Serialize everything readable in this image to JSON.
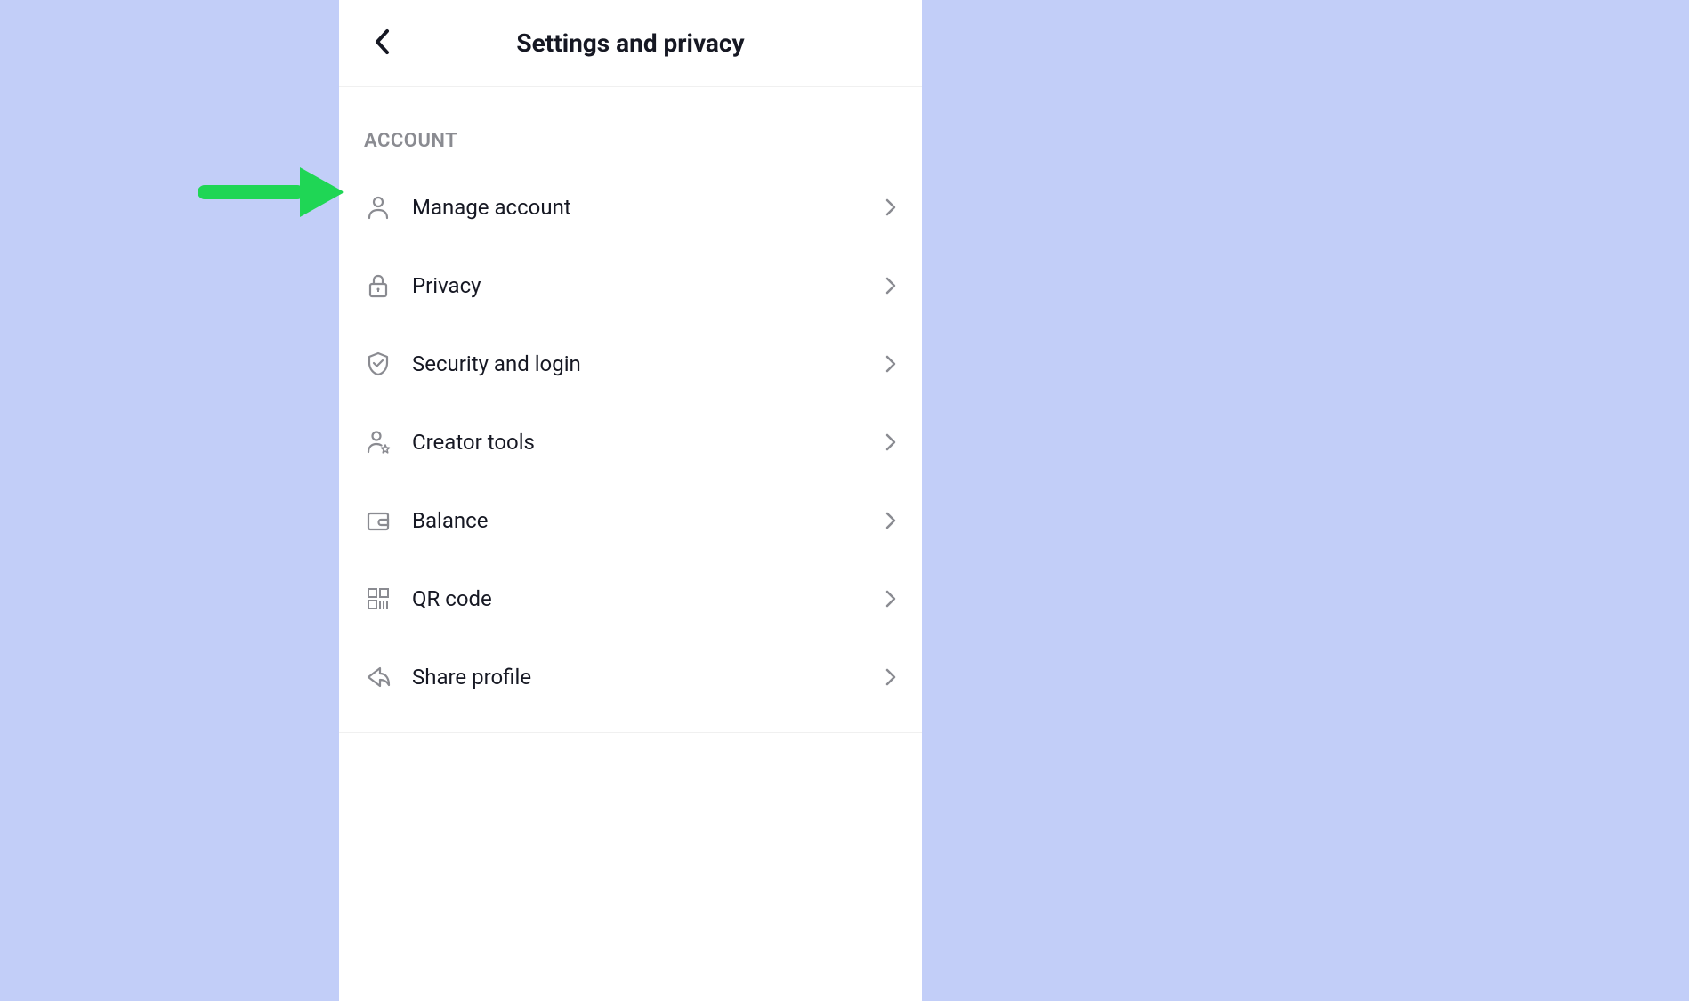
{
  "header": {
    "title": "Settings and privacy"
  },
  "section": {
    "label": "ACCOUNT"
  },
  "items": [
    {
      "label": "Manage account",
      "icon": "user-icon"
    },
    {
      "label": "Privacy",
      "icon": "lock-icon"
    },
    {
      "label": "Security and login",
      "icon": "shield-check-icon"
    },
    {
      "label": "Creator tools",
      "icon": "user-star-icon"
    },
    {
      "label": "Balance",
      "icon": "wallet-icon"
    },
    {
      "label": "QR code",
      "icon": "qr-code-icon"
    },
    {
      "label": "Share profile",
      "icon": "share-icon"
    }
  ],
  "annotation": {
    "arrow_color": "#1fd655"
  }
}
